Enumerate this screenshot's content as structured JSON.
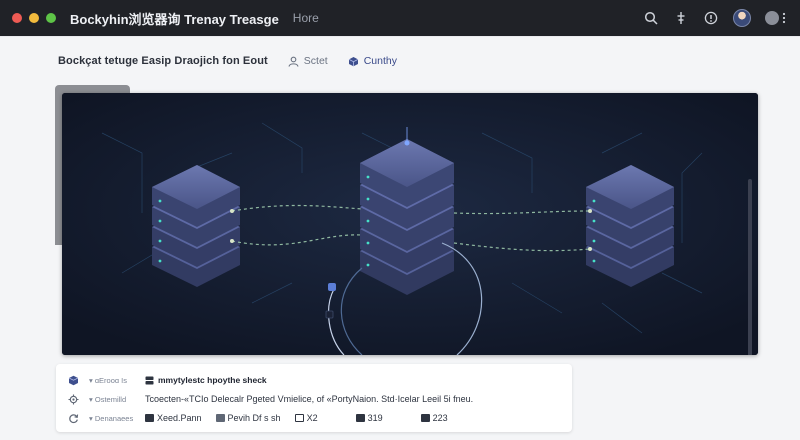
{
  "window": {
    "title": "Bockyhin浏览器询 Trenay Treasge",
    "menu_label": "Hore"
  },
  "toolbar": {
    "breadcrumb": "Bockçat tetuge Easip Draojich fon Eout",
    "link_one_label": "Sctet",
    "link_two_label": "Cunthy"
  },
  "diagram": {
    "background": "#121a2b",
    "server_color": "#4a5588",
    "accent_color": "#6f86ff"
  },
  "details": {
    "row1_key": "ɑErooɑ Is",
    "row1_value": "mmytylestc hpoythe sheck",
    "row2_key": "Ostemilld",
    "row2_value": "Tcoecten-«TCIo Delecalr Pgeted Vmielice, of «PortyNaion. Std·Icelar Leeil 5i fneu.",
    "row3_key": "Denanaees",
    "row3_items": [
      "Xeed.Pann",
      "Pevih Df s sh",
      "X2",
      "319",
      "223"
    ]
  }
}
